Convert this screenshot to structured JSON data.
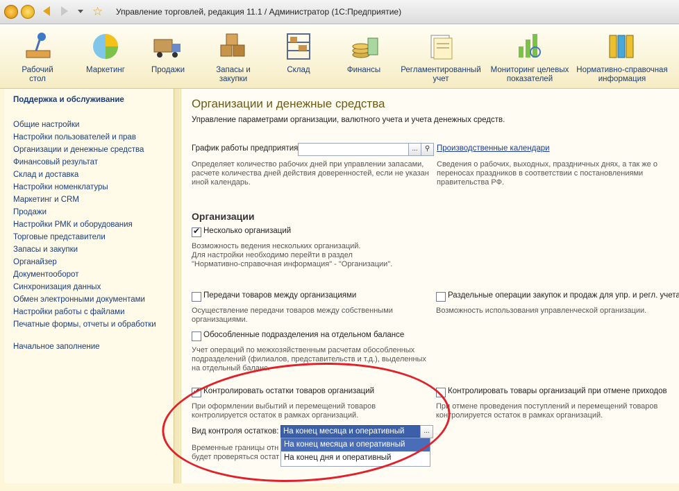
{
  "window": {
    "title": "Управление торговлей, редакция 11.1 / Администратор  (1С:Предприятие)"
  },
  "sections": [
    {
      "label": "Рабочий\nстол",
      "icon": "desk-lamp-icon"
    },
    {
      "label": "Маркетинг",
      "icon": "pie-chart-icon"
    },
    {
      "label": "Продажи",
      "icon": "truck-icon"
    },
    {
      "label": "Запасы и\nзакупки",
      "icon": "boxes-icon"
    },
    {
      "label": "Склад",
      "icon": "shelves-icon"
    },
    {
      "label": "Финансы",
      "icon": "coins-icon"
    },
    {
      "label": "Регламентированный\nучет",
      "icon": "documents-icon"
    },
    {
      "label": "Мониторинг целевых\nпоказателей",
      "icon": "bar-chart-magnifier-icon"
    },
    {
      "label": "Нормативно-справочная\nинформация",
      "icon": "binders-icon"
    }
  ],
  "sidebar": {
    "heading": "Поддержка и обслуживание",
    "items": [
      "Общие настройки",
      "Настройки пользователей и прав",
      "Организации и денежные средства",
      "Финансовый результат",
      "Склад и доставка",
      "Настройки номенклатуры",
      "Маркетинг и CRM",
      "Продажи",
      "Настройки РМК и оборудования",
      "Торговые представители",
      "Запасы и закупки",
      "Органайзер",
      "Документооборот",
      "Синхронизация данных",
      "Обмен электронными документами",
      "Настройки работы с файлами",
      "Печатные формы, отчеты и обработки"
    ],
    "initial": "Начальное заполнение"
  },
  "main": {
    "title": "Организации и денежные средства",
    "subtitle": "Управление параметрами организации,  валютного учета и учета денежных средств.",
    "schedule_label": "График работы предприятия:",
    "schedule_value": "",
    "calendars_link": "Производственные календари",
    "schedule_desc": "Определяет количество рабочих дней при управлении запасами,\nрасчете количества дней действия доверенностей, если не указан\nиной календарь.",
    "calendars_desc": "Сведения о рабочих, выходных, праздничных днях, а так же о\nпереносах праздников в соответствии с постановлениями\nправительства РФ.",
    "orgs_heading": "Организации",
    "multi_orgs": {
      "label": "Несколько организаций",
      "checked": true,
      "desc": "Возможность ведения нескольких организаций.\nДля настройки необходимо перейти в раздел\n\"Нормативно-справочная информация\" - \"Организации\"."
    },
    "transfer": {
      "label": "Передачи товаров между организациями",
      "checked": false,
      "desc": "Осуществление передачи товаров между собственными\nорганизациями."
    },
    "separate_ops": {
      "label": "Раздельные операции закупок и продаж для упр. и регл. учета",
      "checked": false,
      "desc": "Возможность использования управленческой организации."
    },
    "isolated": {
      "label": "Обособленные подразделения на отдельном балансе",
      "checked": false,
      "desc": "Учет операций по межхозяйственным расчетам обособленных\nподразделений (филиалов, представительств и т.д.), выделенных\nна отдельный баланс."
    },
    "control_stock": {
      "label": "Контролировать остатки товаров организаций",
      "checked": true,
      "desc": "При оформлении выбытий и перемещений товаров\nконтролируется остаток в рамках организаций."
    },
    "control_cancel": {
      "label": "Контролировать товары организаций при отмене приходов",
      "checked": false,
      "desc": "При отмене проведения поступлений и перемещений товаров\nконтролируется остаток в рамках организаций."
    },
    "control_type_label": "Вид контроля остатков:",
    "control_type_value": "На конец месяца и оперативный",
    "control_type_options": [
      "На конец месяца и оперативный",
      "На конец дня и оперативный"
    ],
    "temp_desc": "Временные границы отн\nбудет проверяться остат"
  },
  "colors": {
    "accent": "#3b5fa8",
    "highlight_circle": "#e0212a",
    "panel_bg": "#fffbe8"
  }
}
